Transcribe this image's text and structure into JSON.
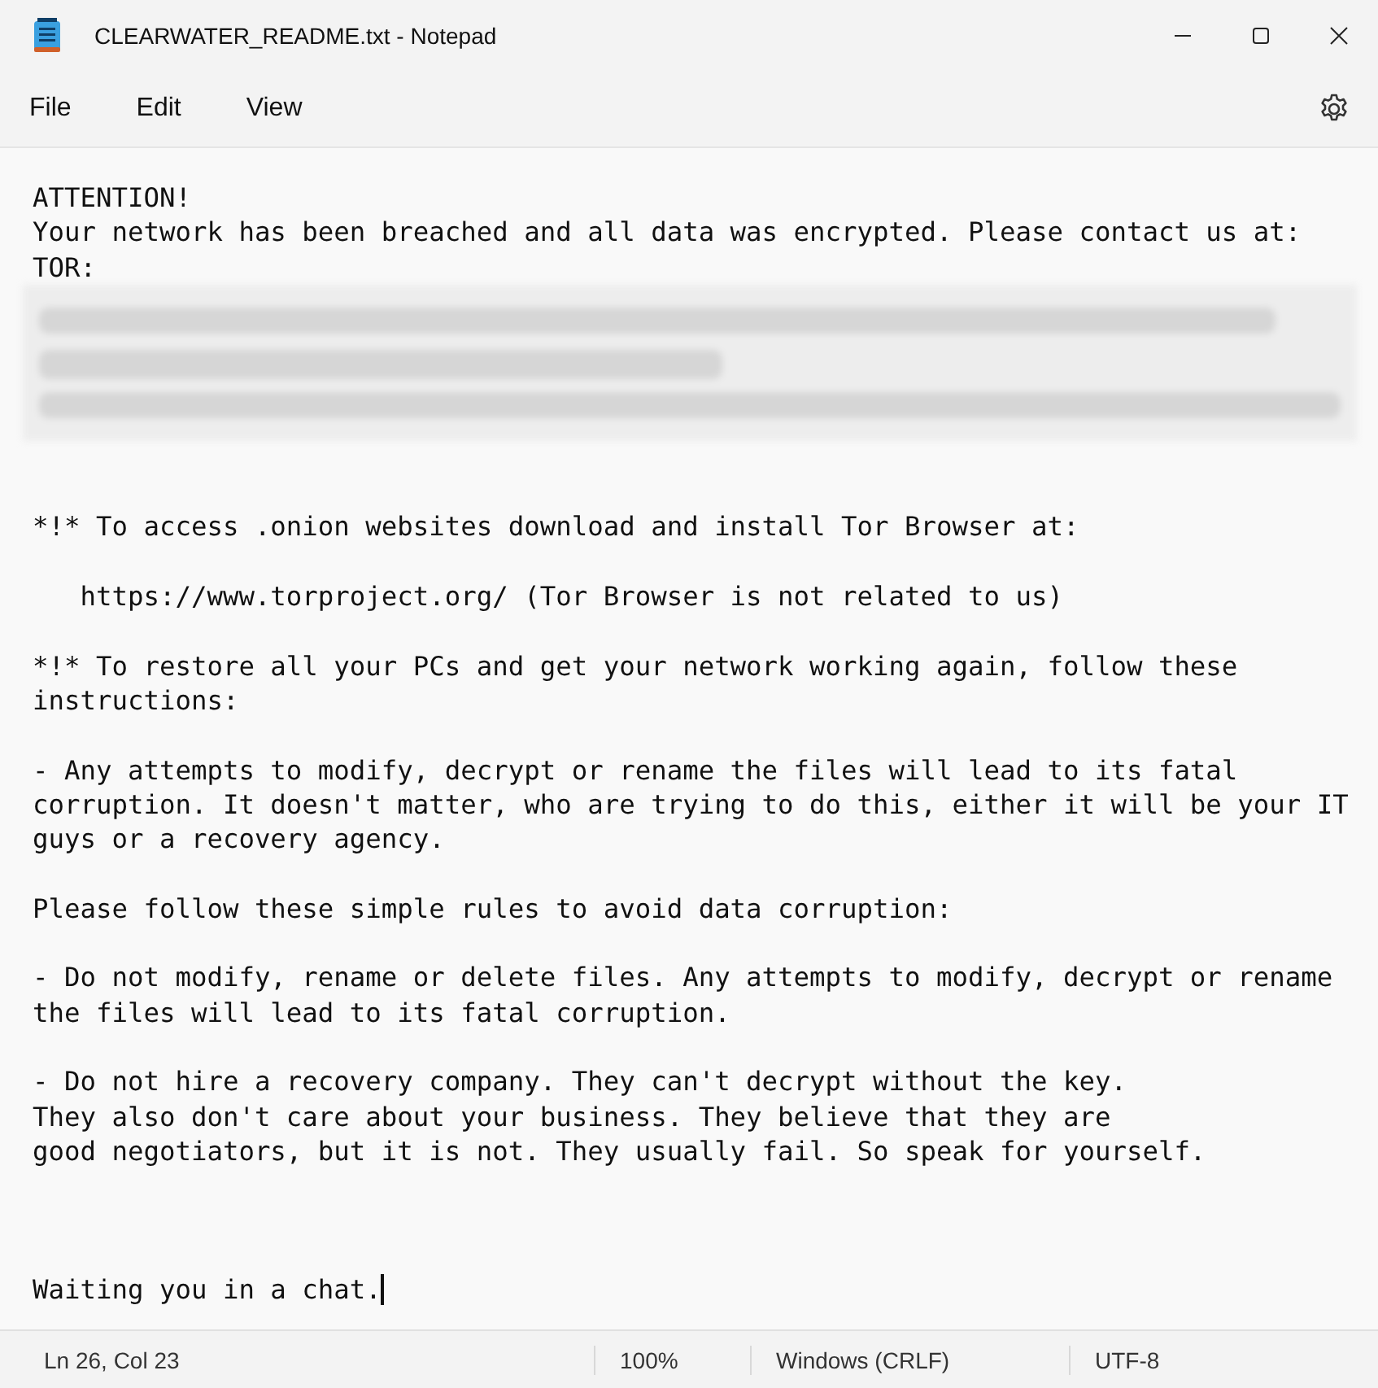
{
  "window": {
    "title": "CLEARWATER_README.txt - Notepad"
  },
  "menu": [
    "File",
    "Edit",
    "View"
  ],
  "document": {
    "lines": [
      {
        "kind": "text",
        "text": "ATTENTION!"
      },
      {
        "kind": "text",
        "text": "Your network has been breached and all data was encrypted. Please contact us at:"
      },
      {
        "kind": "text",
        "text": "TOR:"
      },
      {
        "kind": "redacted"
      },
      {
        "kind": "blank"
      },
      {
        "kind": "blank"
      },
      {
        "kind": "text",
        "text": "*!* To access .onion websites download and install Tor Browser at:"
      },
      {
        "kind": "blank"
      },
      {
        "kind": "text",
        "text": "   https://www.torproject.org/ (Tor Browser is not related to us)"
      },
      {
        "kind": "blank"
      },
      {
        "kind": "text",
        "text": "*!* To restore all your PCs and get your network working again, follow these"
      },
      {
        "kind": "text",
        "text": "instructions:"
      },
      {
        "kind": "blank"
      },
      {
        "kind": "text",
        "text": "- Any attempts to modify, decrypt or rename the files will lead to its fatal"
      },
      {
        "kind": "text",
        "text": "corruption. It doesn't matter, who are trying to do this, either it will be your IT"
      },
      {
        "kind": "text",
        "text": "guys or a recovery agency."
      },
      {
        "kind": "blank"
      },
      {
        "kind": "text",
        "text": "Please follow these simple rules to avoid data corruption:"
      },
      {
        "kind": "blank"
      },
      {
        "kind": "text",
        "text": "- Do not modify, rename or delete files. Any attempts to modify, decrypt or rename"
      },
      {
        "kind": "text",
        "text": "the files will lead to its fatal corruption."
      },
      {
        "kind": "blank"
      },
      {
        "kind": "text",
        "text": "- Do not hire a recovery company. They can't decrypt without the key."
      },
      {
        "kind": "text",
        "text": "They also don't care about your business. They believe that they are"
      },
      {
        "kind": "text",
        "text": "good negotiators, but it is not. They usually fail. So speak for yourself."
      },
      {
        "kind": "blank"
      },
      {
        "kind": "blank"
      },
      {
        "kind": "blank"
      },
      {
        "kind": "cursor",
        "text": "Waiting you in a chat."
      }
    ]
  },
  "status_bar": {
    "position": "Ln 26, Col 23",
    "zoom": "100%",
    "line_endings": "Windows (CRLF)",
    "encoding": "UTF-8"
  }
}
